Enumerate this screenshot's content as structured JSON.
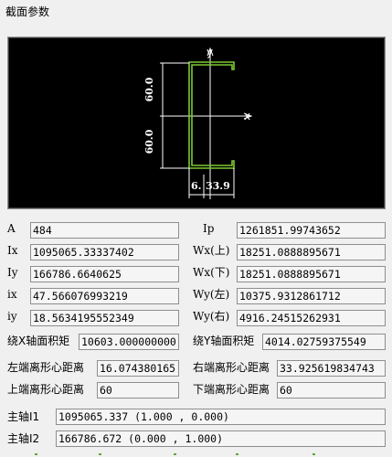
{
  "window": {
    "title": "截面参数"
  },
  "drawing": {
    "axis_y_label": "y",
    "axis_x_label": "x",
    "dim_top": "60.0",
    "dim_bottom": "60.0",
    "dim_web": "6.",
    "dim_flange": "33.9",
    "colors": {
      "background": "#000000",
      "section": "#7cc832",
      "lines": "#ffffff"
    }
  },
  "params": {
    "A": {
      "label": "A",
      "value": "484"
    },
    "Ip": {
      "label": "Ip",
      "value": "1261851.99743652"
    },
    "Ix": {
      "label": "Ix",
      "value": "1095065.33337402"
    },
    "Wx_top": {
      "label": "Wx(上)",
      "value": "18251.0888895671"
    },
    "Iy": {
      "label": "Iy",
      "value": "166786.6640625"
    },
    "Wx_bot": {
      "label": "Wx(下)",
      "value": "18251.0888895671"
    },
    "ix": {
      "label": "ix",
      "value": "47.566076993219"
    },
    "Wy_left": {
      "label": "Wy(左)",
      "value": "10375.9312861712"
    },
    "iy": {
      "label": "iy",
      "value": "18.5634195552349"
    },
    "Wy_right": {
      "label": "Wy(右)",
      "value": "4916.24515262931"
    },
    "Sx": {
      "label": "绕X轴面积矩",
      "value": "10603.000000000"
    },
    "Sy": {
      "label": "绕Y轴面积矩",
      "value": "4014.02759375549"
    },
    "d_left": {
      "label": "左端离形心距离",
      "value": "16.074380165"
    },
    "d_right": {
      "label": "右端离形心距离",
      "value": "33.925619834743"
    },
    "d_top": {
      "label": "上端离形心距离",
      "value": "60"
    },
    "d_bottom": {
      "label": "下端离形心距离",
      "value": "60"
    },
    "I1": {
      "label": "主轴I1",
      "value": "1095065.337  (1.000 , 0.000)"
    },
    "I2": {
      "label": "主轴I2",
      "value": "166786.672  (0.000 , 1.000)"
    }
  }
}
